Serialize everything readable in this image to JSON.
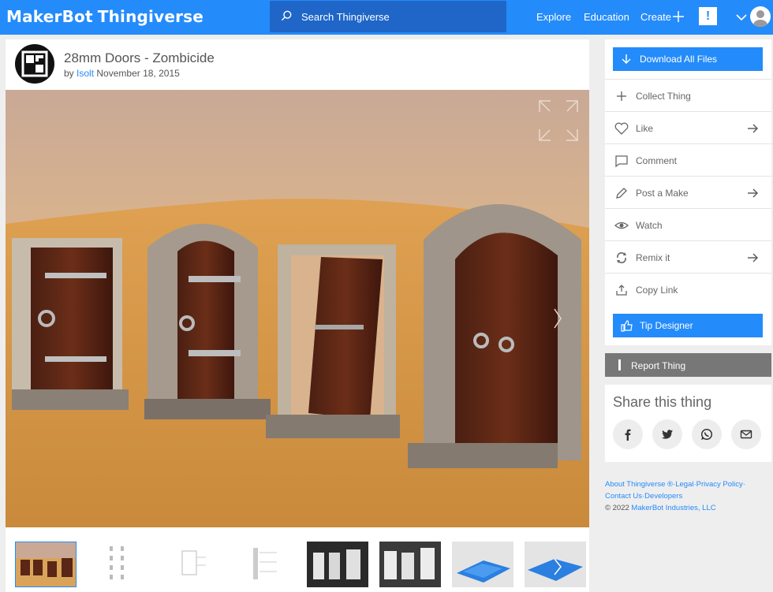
{
  "header": {
    "brand_left": "MakerBot",
    "brand_right": "Thingiverse",
    "search_placeholder": "Search Thingiverse",
    "nav": {
      "explore": "Explore",
      "education": "Education",
      "create": "Create"
    },
    "alert": "!"
  },
  "thing": {
    "title": "28mm Doors - Zombicide",
    "by": "by",
    "author": "Isolt",
    "date": "November 18, 2015"
  },
  "sidebar": {
    "download_label": "Download All Files",
    "actions": [
      {
        "label": "Collect Thing",
        "icon": "plus-icon"
      },
      {
        "label": "Like",
        "icon": "heart-icon"
      },
      {
        "label": "Comment",
        "icon": "comment-icon"
      },
      {
        "label": "Post a Make",
        "icon": "pencil-icon"
      },
      {
        "label": "Watch",
        "icon": "eye-icon"
      },
      {
        "label": "Remix it",
        "icon": "remix-icon"
      },
      {
        "label": "Copy Link",
        "icon": "upload-icon"
      }
    ],
    "tip_label": "Tip Designer",
    "report_label": "Report Thing",
    "share_title": "Share this thing"
  },
  "footer": {
    "about": "About Thingiverse ®",
    "legal": "Legal",
    "privacy": "Privacy Policy",
    "contact": "Contact Us",
    "developers": "Developers",
    "copyright_prefix": "©  2022",
    "company": "MakerBot Industries, LLC"
  },
  "colors": {
    "brand_blue": "#248bfb",
    "search_blue": "#1f66c8",
    "report_gray": "#777777"
  }
}
